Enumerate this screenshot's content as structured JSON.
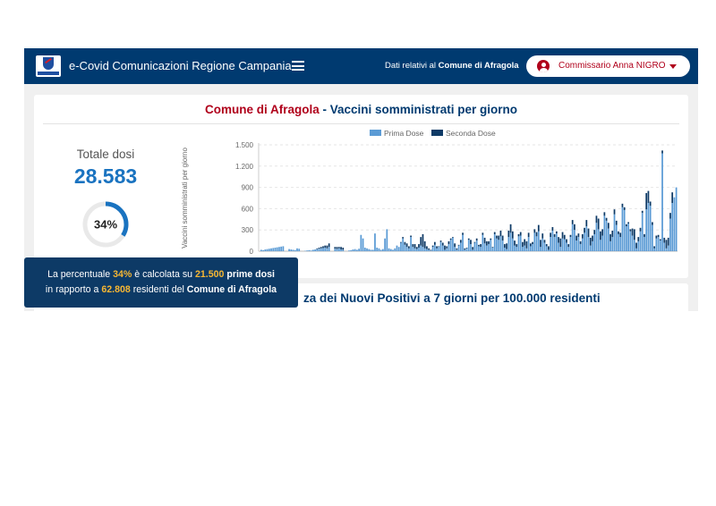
{
  "navbar": {
    "app_title": "e-Covid Comunicazioni Regione Campania",
    "context_prefix": "Dati relativi al",
    "context_municipality": "Comune di Afragola",
    "user_name": "Commissario Anna NIGRO"
  },
  "vaccines_card": {
    "title_municipality": "Comune di Afragola",
    "title_rest": "- Vaccini somministrati per giorno",
    "total_label": "Totale dosi",
    "total_value": "28.583",
    "percentage": "34%",
    "percentage_value": 34
  },
  "tooltip": {
    "p1": "La percentuale",
    "pct": "34%",
    "p2": "è calcolata su",
    "first_doses": "21.500",
    "p3": "prime dosi",
    "p4": "in rapporto a",
    "residents": "62.808",
    "p5": "residenti del",
    "municipality": "Comune di Afragola"
  },
  "positives_card": {
    "title_visible": "za dei Nuovi Positivi a 7 giorni per 100.000 residenti"
  },
  "colors": {
    "navbar": "#003a70",
    "accent_red": "#b0001b",
    "total_blue": "#1a73c0",
    "first_dose": "#5b9bd5",
    "second_dose": "#0e3a66",
    "tooltip_bg": "#0d3a66",
    "tooltip_highlight": "#f7b733"
  },
  "icons": {
    "menu": "hamburger-icon",
    "user": "account-circle-icon",
    "dropdown": "caret-down-icon",
    "logo": "regione-campania-logo"
  },
  "chart_data": {
    "type": "bar",
    "stacked": true,
    "ylabel": "Vaccini somministrati per giorno",
    "ylim": [
      0,
      1500
    ],
    "yticks": [
      "0",
      "300",
      "600",
      "900",
      "1.200",
      "1.500"
    ],
    "ytick_values": [
      0,
      300,
      600,
      900,
      1200,
      1500
    ],
    "grid": true,
    "legend_position": "top",
    "series": [
      {
        "name": "Prima Dose",
        "values": [
          20,
          15,
          25,
          30,
          35,
          40,
          45,
          50,
          55,
          60,
          65,
          70,
          0,
          0,
          30,
          25,
          20,
          15,
          40,
          35,
          0,
          0,
          5,
          10,
          15,
          10,
          20,
          25,
          30,
          35,
          40,
          45,
          50,
          40,
          60,
          0,
          0,
          35,
          30,
          40,
          25,
          20,
          0,
          0,
          10,
          15,
          25,
          30,
          20,
          35,
          230,
          180,
          50,
          40,
          30,
          20,
          20,
          250,
          50,
          40,
          20,
          30,
          180,
          310,
          40,
          30,
          20,
          40,
          80,
          60,
          120,
          180,
          90,
          60,
          40,
          200,
          60,
          40,
          30,
          50,
          80,
          60,
          40,
          30,
          20,
          10,
          60,
          90,
          40,
          60,
          130,
          80,
          20,
          40,
          100,
          160,
          190,
          60,
          20,
          80,
          120,
          230,
          20,
          40,
          160,
          100,
          20,
          120,
          150,
          70,
          60,
          230,
          110,
          80,
          100,
          160,
          50,
          240,
          180,
          160,
          210,
          150,
          50,
          30,
          200,
          260,
          180,
          80,
          60,
          210,
          220,
          60,
          80,
          40,
          200,
          70,
          100,
          260,
          210,
          280,
          60,
          180,
          120,
          70,
          20,
          200,
          290,
          200,
          250,
          120,
          60,
          180,
          170,
          120,
          60,
          200,
          380,
          300,
          150,
          200,
          100,
          180,
          260,
          350,
          200,
          80,
          140,
          240,
          400,
          310,
          160,
          220,
          500,
          430,
          320,
          140,
          200,
          520,
          370,
          240,
          200,
          620,
          580,
          350,
          390,
          280,
          220,
          160,
          40,
          140,
          280,
          540,
          200,
          590,
          680,
          640,
          370,
          40,
          180,
          200,
          150,
          1380,
          120,
          40,
          80,
          460,
          680,
          760,
          900
        ]
      },
      {
        "name": "Seconda Dose",
        "values": [
          0,
          0,
          0,
          0,
          0,
          0,
          0,
          0,
          0,
          0,
          0,
          0,
          0,
          0,
          0,
          0,
          0,
          0,
          0,
          0,
          0,
          0,
          0,
          0,
          0,
          0,
          0,
          0,
          10,
          15,
          20,
          25,
          30,
          40,
          50,
          0,
          0,
          25,
          30,
          20,
          35,
          30,
          0,
          0,
          0,
          0,
          0,
          0,
          0,
          0,
          0,
          0,
          0,
          0,
          0,
          0,
          0,
          0,
          0,
          0,
          0,
          0,
          0,
          0,
          0,
          0,
          0,
          0,
          0,
          0,
          10,
          20,
          40,
          50,
          30,
          20,
          40,
          60,
          30,
          50,
          120,
          180,
          100,
          40,
          20,
          10,
          20,
          40,
          30,
          10,
          20,
          40,
          60,
          30,
          40,
          20,
          10,
          50,
          20,
          10,
          40,
          30,
          20,
          10,
          20,
          60,
          40,
          10,
          30,
          20,
          40,
          30,
          80,
          60,
          40,
          20,
          10,
          30,
          40,
          60,
          80,
          70,
          50,
          80,
          90,
          120,
          100,
          70,
          40,
          30,
          50,
          70,
          90,
          100,
          60,
          40,
          30,
          50,
          60,
          90,
          100,
          70,
          40,
          30,
          50,
          60,
          50,
          40,
          30,
          80,
          120,
          90,
          60,
          50,
          40,
          30,
          60,
          80,
          70,
          50,
          40,
          60,
          70,
          90,
          120,
          110,
          80,
          60,
          100,
          150,
          120,
          90,
          50,
          40,
          80,
          100,
          90,
          70,
          60,
          40,
          60,
          50,
          40,
          30,
          20,
          30,
          100,
          150,
          80,
          60,
          50,
          30,
          40,
          230,
          170,
          60,
          40,
          30,
          40,
          30,
          20,
          40,
          70,
          120,
          110,
          80,
          150
        ]
      }
    ]
  }
}
